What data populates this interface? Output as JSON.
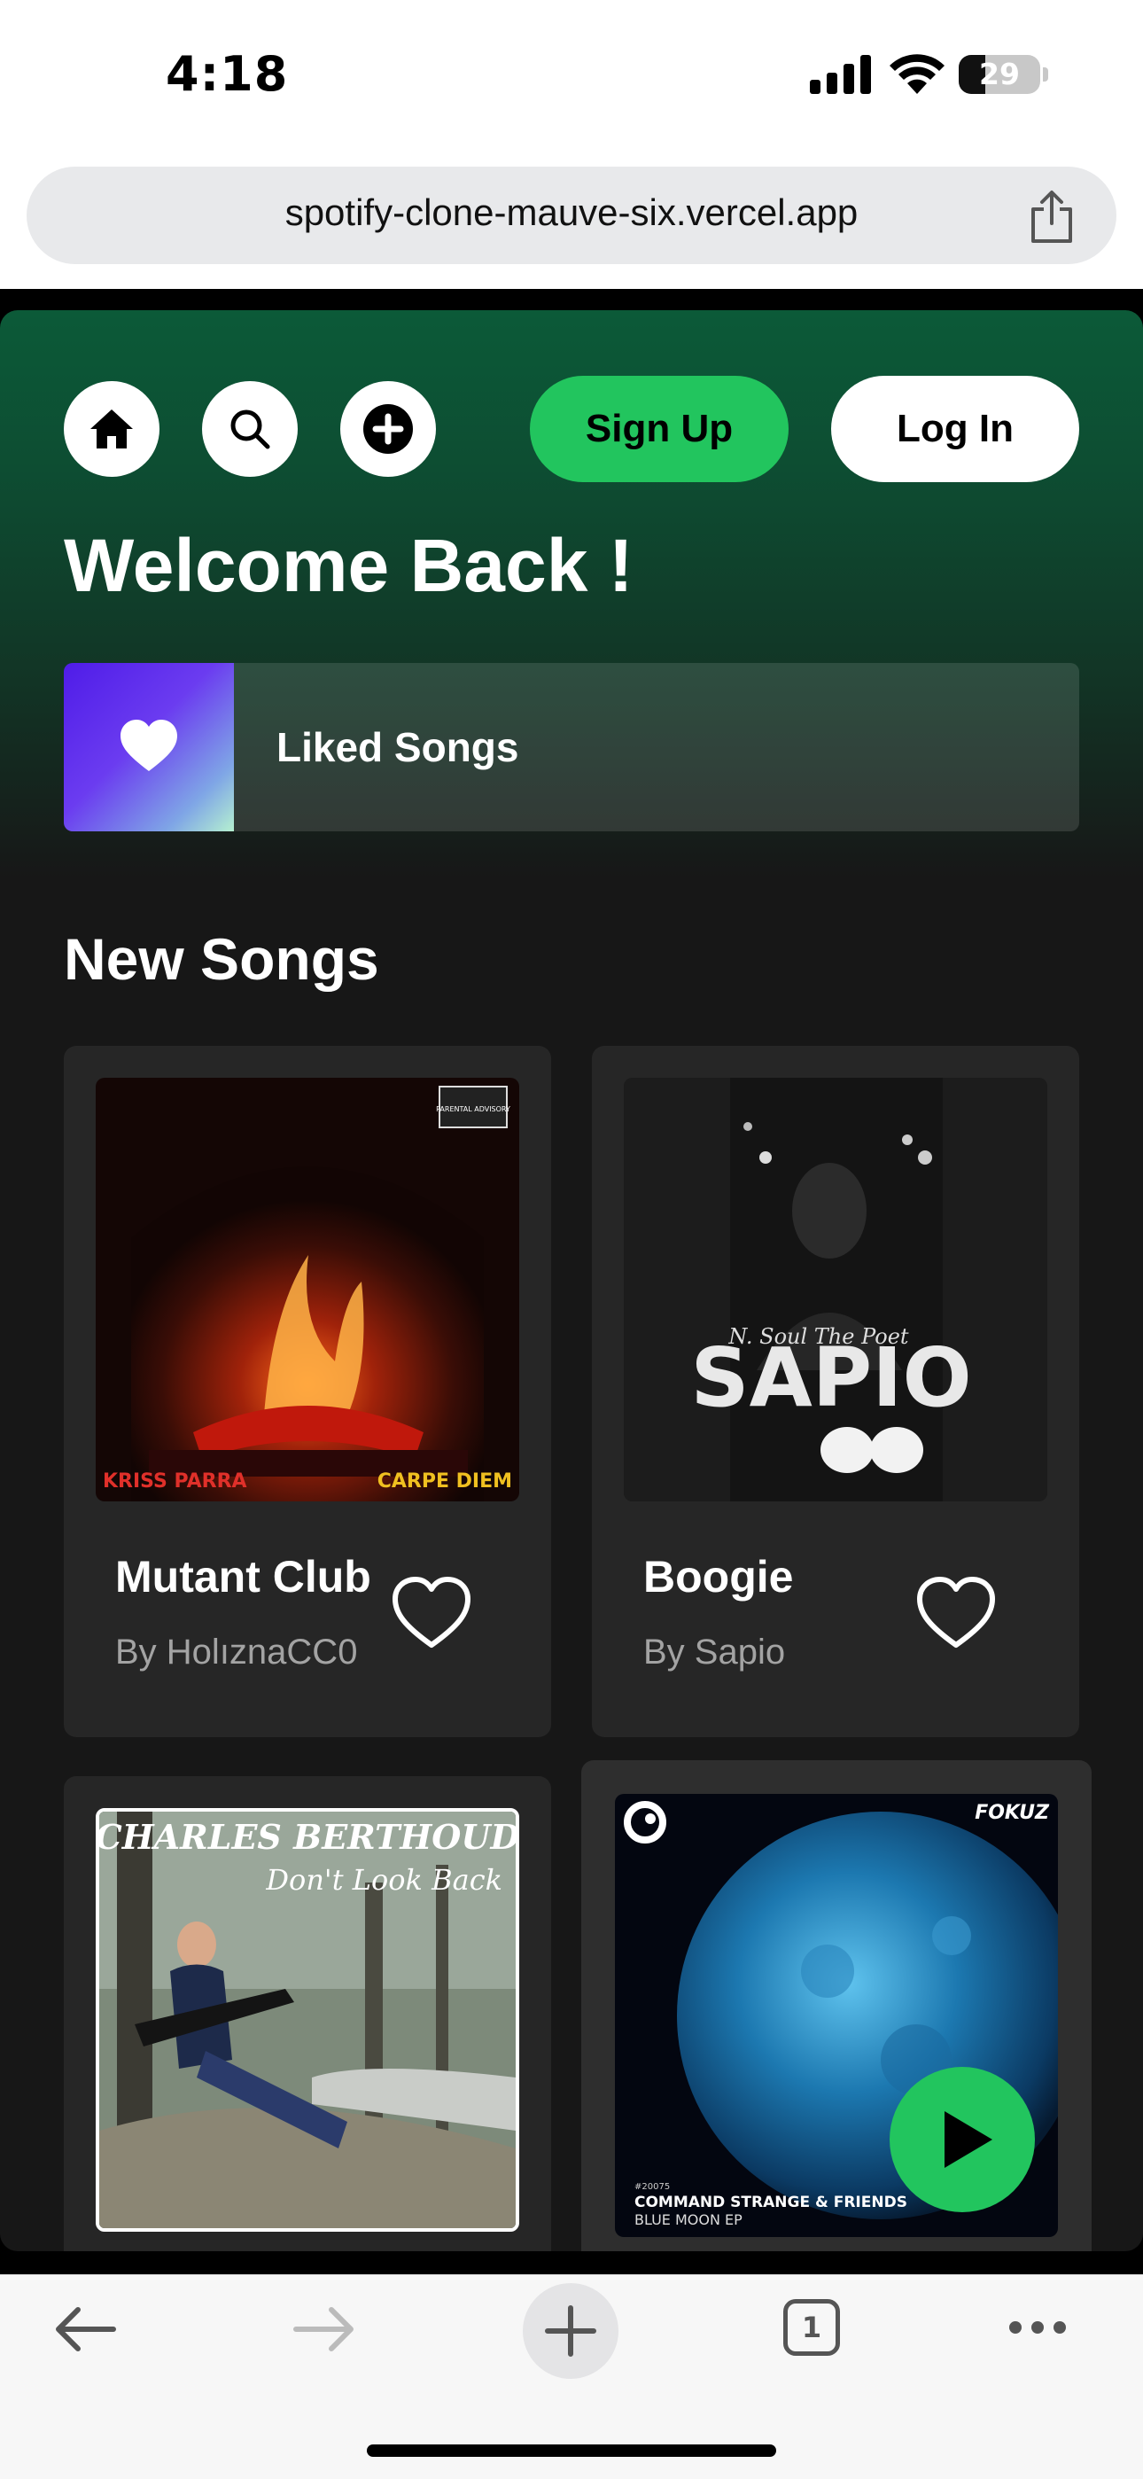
{
  "status": {
    "time": "4:18",
    "battery": "29"
  },
  "browser": {
    "url": "spotify-clone-mauve-six.vercel.app",
    "tab_count": "1"
  },
  "header": {
    "signup_label": "Sign Up",
    "login_label": "Log In"
  },
  "main": {
    "welcome": "Welcome Back !",
    "liked_songs_label": "Liked Songs",
    "new_songs_title": "New Songs",
    "songs": [
      {
        "title": "Mutant Club",
        "artist": "By HolıznaCC0",
        "cover_text_left": "KRISS PARRA",
        "cover_text_right": "CARPE DIEM",
        "cover_badge": "PARENTAL ADVISORY"
      },
      {
        "title": "Boogie",
        "artist": "By Sapio",
        "cover_text": "SAPIO",
        "cover_script": "N. Soul The Poet"
      },
      {
        "title": "",
        "artist": "",
        "cover_text_top": "CHARLES BERTHOUD",
        "cover_text_sub": "Don't Look Back"
      },
      {
        "title": "",
        "artist": "",
        "cover_text_label": "FOKUZ",
        "cover_text_code": "#20075",
        "cover_text_main": "COMMAND STRANGE & FRIENDS",
        "cover_text_sub": "BLUE MOON EP"
      }
    ]
  },
  "colors": {
    "accent": "#22c55e",
    "header_green": "#0c5a38",
    "card_bg": "#262626",
    "page_bg": "#171717"
  }
}
